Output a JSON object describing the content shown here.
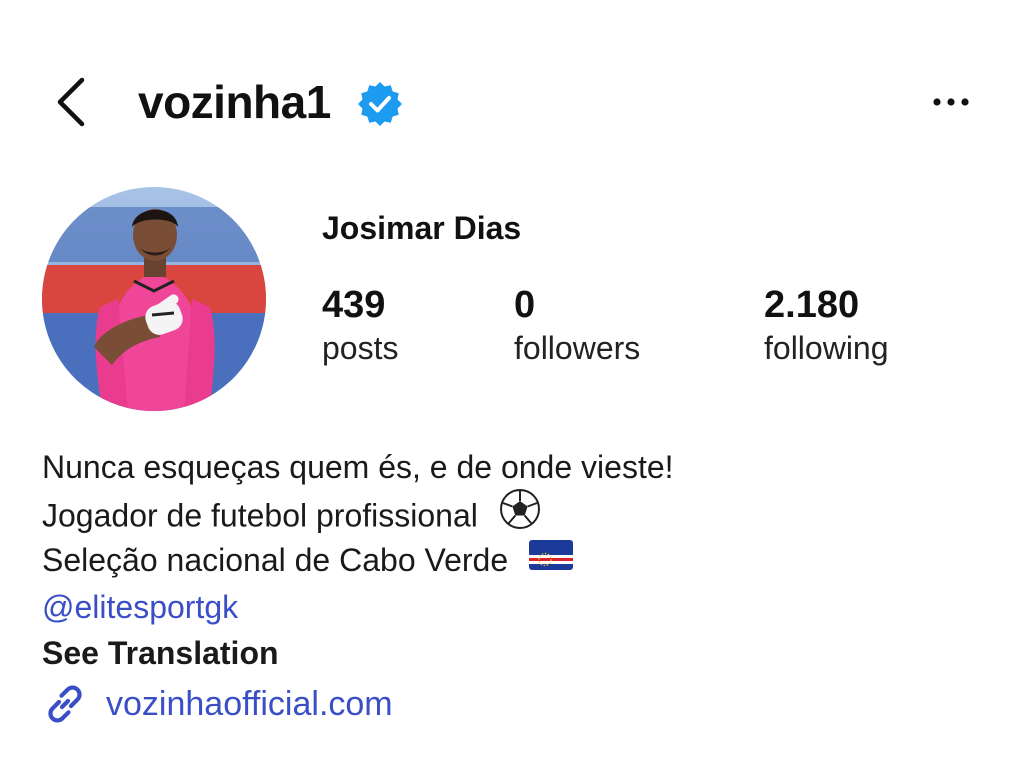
{
  "header": {
    "username": "vozinha1",
    "verified": true,
    "back_icon": "chevron-left-icon",
    "more_icon": "more-horizontal-icon",
    "verified_icon": "verified-badge-icon"
  },
  "profile": {
    "display_name": "Josimar Dias",
    "avatar_icon": "profile-photo"
  },
  "stats": [
    {
      "value": "439",
      "label": "posts"
    },
    {
      "value": "0",
      "label": "followers"
    },
    {
      "value": "2.180",
      "label": "following"
    }
  ],
  "bio": {
    "line1": "Nunca esqueças quem és, e de onde vieste!",
    "line2": "Jogador de futebol profissional",
    "line2_emoji": "soccer-ball-icon",
    "line3": "Seleção nacional de Cabo Verde",
    "line3_emoji": "cape-verde-flag-icon",
    "mention": "@elitesportgk",
    "see_translation": "See Translation"
  },
  "link": {
    "text": "vozinhaofficial.com",
    "icon": "link-icon"
  },
  "colors": {
    "text": "#111111",
    "link": "#3a4fc7",
    "verified_blue": "#1d9bf0",
    "jersey_pink": "#f0469a"
  }
}
